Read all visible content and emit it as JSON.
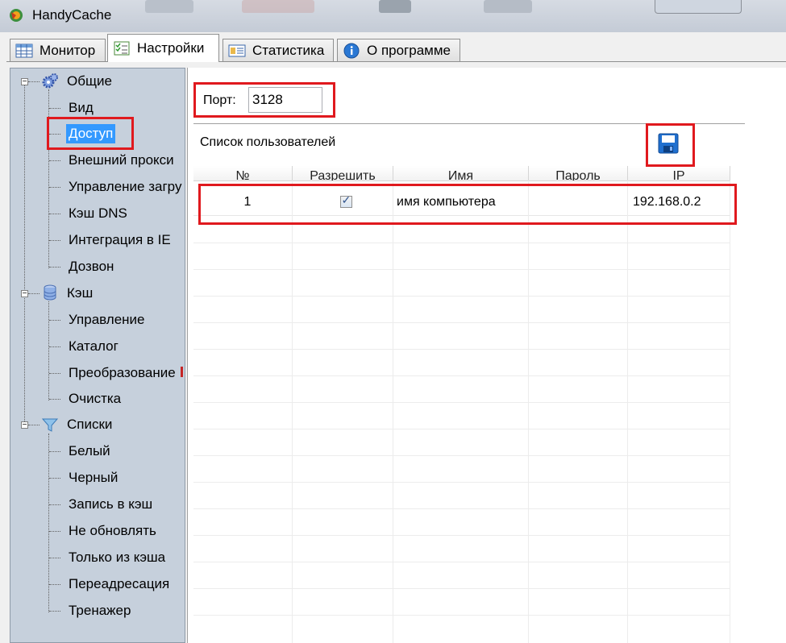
{
  "window": {
    "title": "HandyCache"
  },
  "tabs": [
    {
      "label": "Монитор",
      "icon": "grid-table-icon",
      "active": false
    },
    {
      "label": "Настройки",
      "icon": "checklist-icon",
      "active": true
    },
    {
      "label": "Статистика",
      "icon": "stats-card-icon",
      "active": false
    },
    {
      "label": "О программе",
      "icon": "info-icon",
      "active": false
    }
  ],
  "tree": {
    "groups": [
      {
        "label": "Общие",
        "icon": "gears-icon",
        "items": [
          "Вид",
          "Доступ",
          "Внешний прокси",
          "Управление загру",
          "Кэш DNS",
          "Интеграция в IE",
          "Дозвон"
        ]
      },
      {
        "label": "Кэш",
        "icon": "database-icon",
        "items": [
          "Управление",
          "Каталог",
          "Преобразование",
          "Очистка"
        ]
      },
      {
        "label": "Списки",
        "icon": "filter-funnel-icon",
        "items": [
          "Белый",
          "Черный",
          "Запись в кэш",
          "Не обновлять",
          "Только из кэша",
          "Переадресация",
          "Тренажер"
        ]
      }
    ],
    "selected": "Доступ"
  },
  "settings": {
    "port_label": "Порт:",
    "port_value": "3128",
    "users_label": "Список пользователей",
    "save_icon": "floppy-save-icon"
  },
  "grid": {
    "columns": [
      "№",
      "Разрешить",
      "Имя",
      "Пароль",
      "IP"
    ],
    "rows": [
      {
        "num": "1",
        "allow": true,
        "name": "имя компьютера",
        "password": "",
        "ip": "192.168.0.2"
      }
    ]
  },
  "colors": {
    "highlight": "#e0191e",
    "selection": "#3399ff",
    "tree_bg": "#c6d0dc"
  }
}
